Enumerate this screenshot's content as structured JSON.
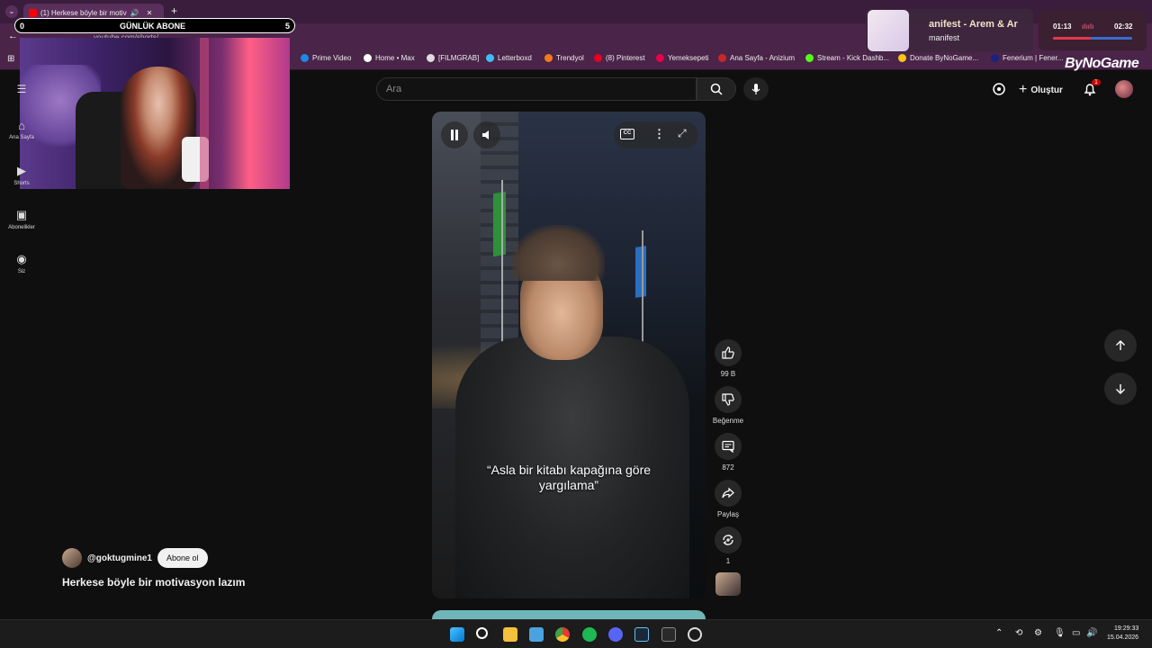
{
  "browser": {
    "tab_title": "(1) Herkese böyle bir motiv",
    "url": "youtube.com/shorts/..."
  },
  "bookmarks": [
    {
      "label": "Prime Video",
      "color": "#1e88e5"
    },
    {
      "label": "Home • Max",
      "color": "#ffffff"
    },
    {
      "label": "[FILMGRAB]",
      "color": "#dddddd"
    },
    {
      "label": "Letterboxd",
      "color": "#40bcf4"
    },
    {
      "label": "Trendyol",
      "color": "#f27a1a"
    },
    {
      "label": "(8) Pinterest",
      "color": "#e60023"
    },
    {
      "label": "Yemeksepeti",
      "color": "#ea004b"
    },
    {
      "label": "Ana Sayfa - Anizium",
      "color": "#c62828"
    },
    {
      "label": "Stream - Kick Dashb...",
      "color": "#53fc18"
    },
    {
      "label": "Donate ByNoGame...",
      "color": "#f5c518"
    },
    {
      "label": "Fenerium | Fener...",
      "color": "#1a237e"
    }
  ],
  "overlay": {
    "sub_label": "GÜNLÜK ABONE",
    "sub_min": "0",
    "sub_max": "5",
    "brand": "ByNoGame"
  },
  "music": {
    "title": "anifest - Arem & Ar",
    "subtitle": "manifest",
    "time_current": "01:13",
    "time_total": "02:32",
    "progress": 0.48
  },
  "youtube": {
    "search_placeholder": "Ara",
    "create_label": "Oluştur",
    "notif_count": "1",
    "sidebar": [
      {
        "label": "Ana Sayfa",
        "icon": "home-icon"
      },
      {
        "label": "Shorts",
        "icon": "shorts-icon"
      },
      {
        "label": "Abonelikler",
        "icon": "subscriptions-icon"
      },
      {
        "label": "Siz",
        "icon": "you-icon"
      }
    ],
    "short": {
      "caption_line1": "“Asla bir kitabı kapağına göre",
      "caption_line2": "yargılama”",
      "likes": "99 B",
      "dislike_label": "Beğenme",
      "comments": "872",
      "share_label": "Paylaş",
      "remix_count": "1",
      "channel": "@goktugmine1",
      "subscribe_label": "Abone ol",
      "title": "Herkese böyle bir motivasyon lazım"
    }
  },
  "taskbar": {
    "time": "19:29:33",
    "date": "15.04.2026"
  }
}
